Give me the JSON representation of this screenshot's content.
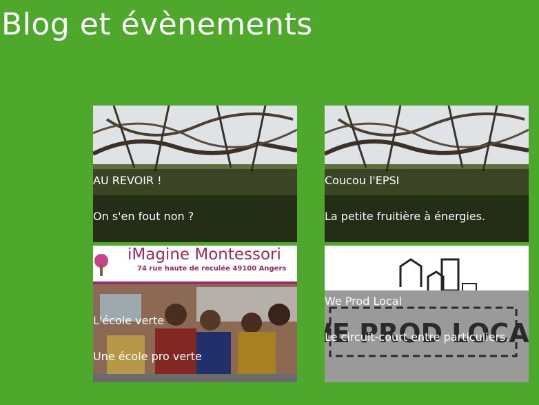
{
  "page": {
    "title": "Blog et évènements"
  },
  "cards": [
    {
      "title": "AU REVOIR !",
      "subtitle": "On s'en fout non ?"
    },
    {
      "title": "Coucou l'EPSI",
      "subtitle": "La petite fruitière à énergies."
    },
    {
      "title": "L'école verte",
      "subtitle": "Une école pro verte",
      "image_text": {
        "name": "iMagine Montessori",
        "address": "74 rue haute de reculée 49100 Angers"
      }
    },
    {
      "title": "We Prod Local",
      "subtitle": "Le circuit-court entre particuliers.",
      "image_text": "WE PROD LOCAL"
    }
  ],
  "colors": {
    "background": "#4ea82c",
    "text": "#ffffff",
    "brand_purple": "#9b2a6a"
  }
}
